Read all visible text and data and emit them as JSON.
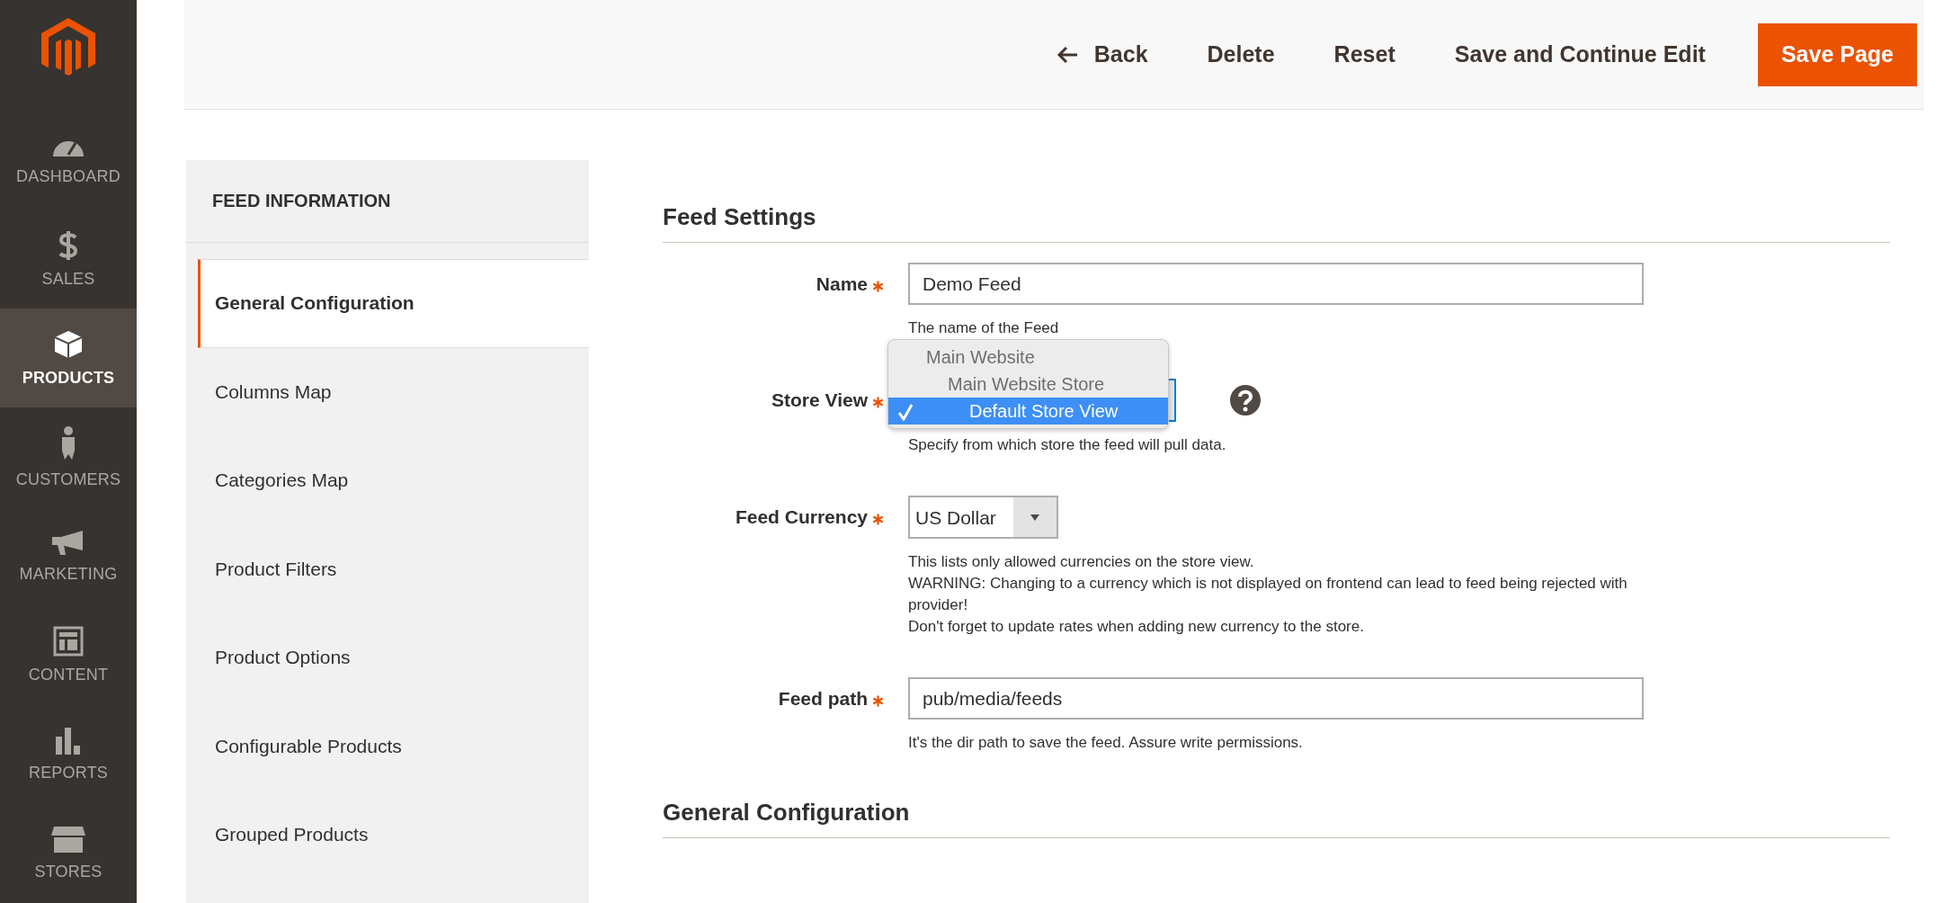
{
  "sidebar": {
    "items": [
      {
        "label": "DASHBOARD",
        "selected": false
      },
      {
        "label": "SALES",
        "selected": false
      },
      {
        "label": "PRODUCTS",
        "selected": true
      },
      {
        "label": "CUSTOMERS",
        "selected": false
      },
      {
        "label": "MARKETING",
        "selected": false
      },
      {
        "label": "CONTENT",
        "selected": false
      },
      {
        "label": "REPORTS",
        "selected": false
      },
      {
        "label": "STORES",
        "selected": false
      }
    ]
  },
  "toolbar": {
    "back": "Back",
    "buttons": [
      "Delete",
      "Reset",
      "Save and Continue Edit"
    ],
    "primary": "Save Page"
  },
  "tabs_panel": {
    "title": "FEED INFORMATION",
    "items": [
      {
        "label": "General Configuration",
        "selected": true
      },
      {
        "label": "Columns Map",
        "selected": false
      },
      {
        "label": "Categories Map",
        "selected": false
      },
      {
        "label": "Product Filters",
        "selected": false
      },
      {
        "label": "Product Options",
        "selected": false
      },
      {
        "label": "Configurable Products",
        "selected": false
      },
      {
        "label": "Grouped Products",
        "selected": false
      }
    ]
  },
  "sections": [
    {
      "title": "Feed Settings",
      "fields": [
        {
          "kind": "input",
          "label": "Name",
          "required": true,
          "value": "Demo Feed",
          "hints": [
            "The name of the Feed"
          ]
        },
        {
          "kind": "select",
          "label": "Store View",
          "required": true,
          "help": true,
          "expanded": true,
          "options": [
            {
              "label": "Main Website",
              "selected": false,
              "children": [
                {
                  "label": "Main Website Store",
                  "selected": false,
                  "children": [
                    {
                      "label": "Default Store View",
                      "selected": true
                    }
                  ]
                }
              ]
            }
          ],
          "hints": [
            "Specify from which store the feed will pull data."
          ]
        },
        {
          "kind": "select",
          "label": "Feed Currency",
          "required": true,
          "value": "US Dollar",
          "hints": [
            "This lists only allowed currencies on the store view.",
            "WARNING: Changing to a currency which is not displayed on frontend can lead to feed being rejected with provider!",
            "Don't forget to update rates when adding new currency to the store."
          ]
        },
        {
          "kind": "input",
          "label": "Feed path",
          "required": true,
          "value": "pub/media/feeds",
          "hints": [
            "It's the dir path to save the feed. Assure write permissions."
          ]
        }
      ]
    },
    {
      "title": "General Configuration"
    }
  ]
}
